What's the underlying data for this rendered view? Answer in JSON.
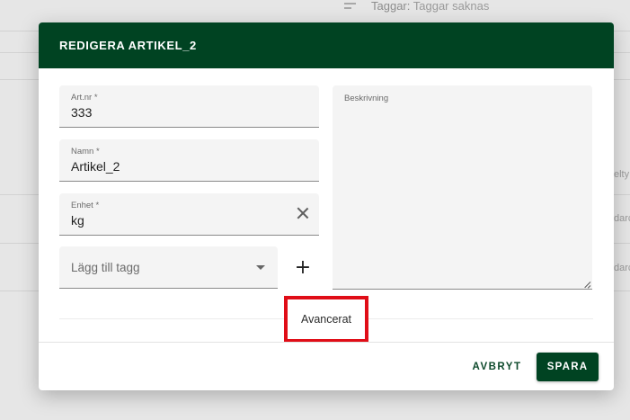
{
  "background": {
    "filter_label": "Taggar:",
    "filter_value": "Taggar saknas",
    "columns": [
      "elty",
      "darc",
      "darc"
    ]
  },
  "dialog": {
    "title": "REDIGERA ARTIKEL_2",
    "fields": {
      "artnr": {
        "label": "Art.nr *",
        "value": "333"
      },
      "namn": {
        "label": "Namn *",
        "value": "Artikel_2"
      },
      "enhet": {
        "label": "Enhet *",
        "value": "kg"
      }
    },
    "tag_select": {
      "placeholder": "Lägg till tagg"
    },
    "add_tag_symbol": "+",
    "description": {
      "label": "Beskrivning"
    },
    "advanced_label": "Avancerat",
    "cancel_label": "AVBRYT",
    "save_label": "SPARA"
  },
  "colors": {
    "primary": "#004322",
    "highlight": "#e00d17"
  }
}
